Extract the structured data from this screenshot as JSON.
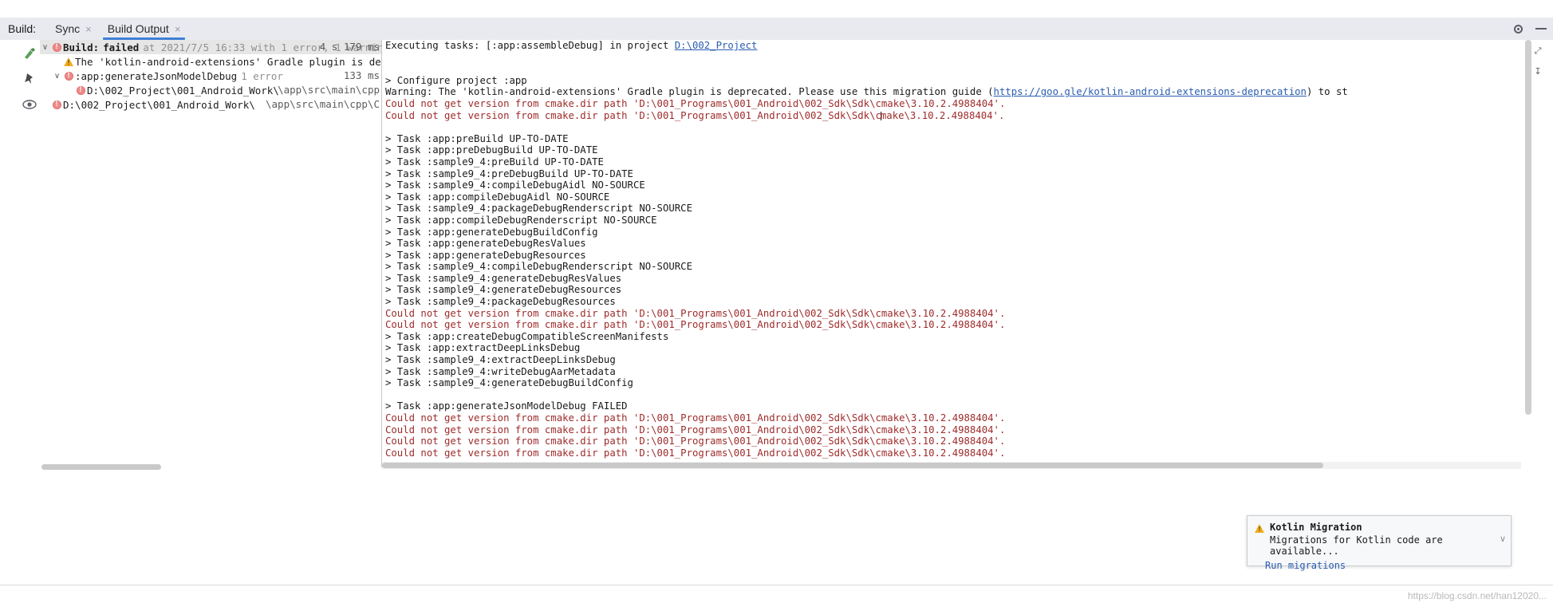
{
  "window": {
    "tool_title": "Build:",
    "gear_icon": "gear-icon",
    "minimize_icon": "minimize-icon"
  },
  "tabs": [
    {
      "label": "Sync",
      "close": "×",
      "active": false
    },
    {
      "label": "Build Output",
      "close": "×",
      "active": true
    }
  ],
  "gutter_icons": [
    {
      "name": "hammer-icon"
    },
    {
      "name": "pin-icon"
    },
    {
      "name": "eye-icon"
    }
  ],
  "right_edge_icons": [
    {
      "name": "collapse-icon",
      "glyph": "⤢"
    },
    {
      "name": "scroll-to-end-icon",
      "glyph": "↧"
    }
  ],
  "tree": {
    "rows": [
      {
        "indent": 0,
        "arrow": "∨",
        "severity": "error",
        "label": "Build:",
        "label2": "failed",
        "muted": "at 2021/7/5 16:33 with 1 error, 1 warning",
        "right": "4 s 179 ms",
        "selected": true
      },
      {
        "indent": 1,
        "arrow": "",
        "severity": "warning",
        "label": "The 'kotlin-android-extensions' Gradle plugin is deprecated. Plea",
        "label2": "",
        "muted": "",
        "right": "",
        "selected": false
      },
      {
        "indent": 1,
        "arrow": "∨",
        "severity": "error",
        "label": ":app:generateJsonModelDebug",
        "label2": "",
        "muted": "1 error",
        "right": "133 ms",
        "selected": false
      },
      {
        "indent": 2,
        "arrow": "",
        "severity": "error",
        "label": "D:\\002_Project\\001_Android_Work\\",
        "label2": "",
        "muted": "",
        "right": "\\app\\src\\main\\cpp",
        "selected": false
      },
      {
        "indent": 0,
        "arrow": "",
        "severity": "error",
        "label": "D:\\002_Project\\001_Android_Work\\",
        "label2": "",
        "muted": "",
        "right": "\\app\\src\\main\\cpp\\C",
        "selected": false
      }
    ]
  },
  "console": {
    "lines": [
      {
        "t": "text",
        "segments": [
          {
            "text": "Executing tasks: [:app:assembleDebug] in project ",
            "style": "plain"
          },
          {
            "text": "D:\\002_Project",
            "style": "link"
          }
        ]
      },
      {
        "t": "blank"
      },
      {
        "t": "blank"
      },
      {
        "t": "plain",
        "text": "> Configure project :app"
      },
      {
        "t": "text",
        "segments": [
          {
            "text": "Warning: The 'kotlin-android-extensions' Gradle plugin is deprecated. Please use this migration guide (",
            "style": "plain"
          },
          {
            "text": "https://goo.gle/kotlin-android-extensions-deprecation",
            "style": "link"
          },
          {
            "text": ") to st",
            "style": "plain"
          }
        ]
      },
      {
        "t": "err",
        "text": "Could not get version from cmake.dir path 'D:\\001_Programs\\001_Android\\002_Sdk\\Sdk\\cmake\\3.10.2.4988404'."
      },
      {
        "t": "err_caret",
        "before": "Could not get version from cmake.dir path 'D:\\001_Programs\\001_Android\\002_Sdk\\Sdk\\c",
        "after": "make\\3.10.2.4988404'."
      },
      {
        "t": "blank"
      },
      {
        "t": "plain",
        "text": "> Task :app:preBuild UP-TO-DATE"
      },
      {
        "t": "plain",
        "text": "> Task :app:preDebugBuild UP-TO-DATE"
      },
      {
        "t": "plain",
        "text": "> Task :sample9_4:preBuild UP-TO-DATE"
      },
      {
        "t": "plain",
        "text": "> Task :sample9_4:preDebugBuild UP-TO-DATE"
      },
      {
        "t": "plain",
        "text": "> Task :sample9_4:compileDebugAidl NO-SOURCE"
      },
      {
        "t": "plain",
        "text": "> Task :app:compileDebugAidl NO-SOURCE"
      },
      {
        "t": "plain",
        "text": "> Task :sample9_4:packageDebugRenderscript NO-SOURCE"
      },
      {
        "t": "plain",
        "text": "> Task :app:compileDebugRenderscript NO-SOURCE"
      },
      {
        "t": "plain",
        "text": "> Task :app:generateDebugBuildConfig"
      },
      {
        "t": "plain",
        "text": "> Task :app:generateDebugResValues"
      },
      {
        "t": "plain",
        "text": "> Task :app:generateDebugResources"
      },
      {
        "t": "plain",
        "text": "> Task :sample9_4:compileDebugRenderscript NO-SOURCE"
      },
      {
        "t": "plain",
        "text": "> Task :sample9_4:generateDebugResValues"
      },
      {
        "t": "plain",
        "text": "> Task :sample9_4:generateDebugResources"
      },
      {
        "t": "plain",
        "text": "> Task :sample9_4:packageDebugResources"
      },
      {
        "t": "err",
        "text": "Could not get version from cmake.dir path 'D:\\001_Programs\\001_Android\\002_Sdk\\Sdk\\cmake\\3.10.2.4988404'."
      },
      {
        "t": "err",
        "text": "Could not get version from cmake.dir path 'D:\\001_Programs\\001_Android\\002_Sdk\\Sdk\\cmake\\3.10.2.4988404'."
      },
      {
        "t": "plain",
        "text": "> Task :app:createDebugCompatibleScreenManifests"
      },
      {
        "t": "plain",
        "text": "> Task :app:extractDeepLinksDebug"
      },
      {
        "t": "plain",
        "text": "> Task :sample9_4:extractDeepLinksDebug"
      },
      {
        "t": "plain",
        "text": "> Task :sample9_4:writeDebugAarMetadata"
      },
      {
        "t": "plain",
        "text": "> Task :sample9_4:generateDebugBuildConfig"
      },
      {
        "t": "blank"
      },
      {
        "t": "plain",
        "text": "> Task :app:generateJsonModelDebug FAILED"
      },
      {
        "t": "err",
        "text": "Could not get version from cmake.dir path 'D:\\001_Programs\\001_Android\\002_Sdk\\Sdk\\cmake\\3.10.2.4988404'."
      },
      {
        "t": "err",
        "text": "Could not get version from cmake.dir path 'D:\\001_Programs\\001_Android\\002_Sdk\\Sdk\\cmake\\3.10.2.4988404'."
      },
      {
        "t": "err",
        "text": "Could not get version from cmake.dir path 'D:\\001_Programs\\001_Android\\002_Sdk\\Sdk\\cmake\\3.10.2.4988404'."
      },
      {
        "t": "err",
        "text": "Could not get version from cmake.dir path 'D:\\001_Programs\\001_Android\\002_Sdk\\Sdk\\cmake\\3.10.2.4988404'."
      }
    ]
  },
  "notification": {
    "icon": "warning-icon",
    "title": "Kotlin Migration",
    "message": "Migrations for Kotlin code are available...",
    "action": "Run migrations",
    "chevron": "∨"
  },
  "watermark": "https://blog.csdn.net/han12020..."
}
